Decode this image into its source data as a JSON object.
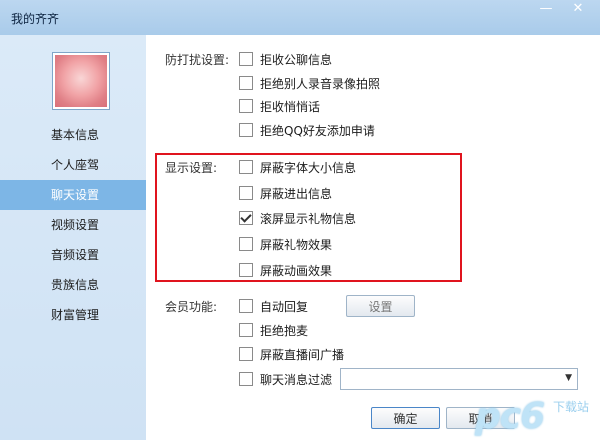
{
  "window": {
    "title": "我的齐齐",
    "minimize_glyph": "—",
    "close_glyph": "✕"
  },
  "sidebar": {
    "items": [
      {
        "label": "基本信息",
        "active": false
      },
      {
        "label": "个人座驾",
        "active": false
      },
      {
        "label": "聊天设置",
        "active": true
      },
      {
        "label": "视频设置",
        "active": false
      },
      {
        "label": "音频设置",
        "active": false
      },
      {
        "label": "贵族信息",
        "active": false
      },
      {
        "label": "财富管理",
        "active": false
      }
    ]
  },
  "anti_harass": {
    "label": "防打扰设置:",
    "options": [
      {
        "label": "拒收公聊信息",
        "checked": false
      },
      {
        "label": "拒绝别人录音录像拍照",
        "checked": false
      },
      {
        "label": "拒收悄悄话",
        "checked": false
      },
      {
        "label": "拒绝QQ好友添加申请",
        "checked": false
      }
    ]
  },
  "display": {
    "label": "显示设置:",
    "options": [
      {
        "label": "屏蔽字体大小信息",
        "checked": false
      },
      {
        "label": "屏蔽进出信息",
        "checked": false
      },
      {
        "label": "滚屏显示礼物信息",
        "checked": true
      },
      {
        "label": "屏蔽礼物效果",
        "checked": false
      },
      {
        "label": "屏蔽动画效果",
        "checked": false
      }
    ]
  },
  "member": {
    "label": "会员功能:",
    "options": [
      {
        "label": "自动回复",
        "checked": false
      },
      {
        "label": "拒绝抱麦",
        "checked": false
      },
      {
        "label": "屏蔽直播间广播",
        "checked": false
      },
      {
        "label": "聊天消息过滤",
        "checked": false
      }
    ],
    "settings_button": "设置",
    "filter_value": ""
  },
  "buttons": {
    "ok": "确定",
    "cancel": "取消"
  },
  "watermark": {
    "text": "pc6",
    "sub": "下载站"
  },
  "colors": {
    "highlight": "#e0141e",
    "active_nav": "#7db6e6"
  }
}
